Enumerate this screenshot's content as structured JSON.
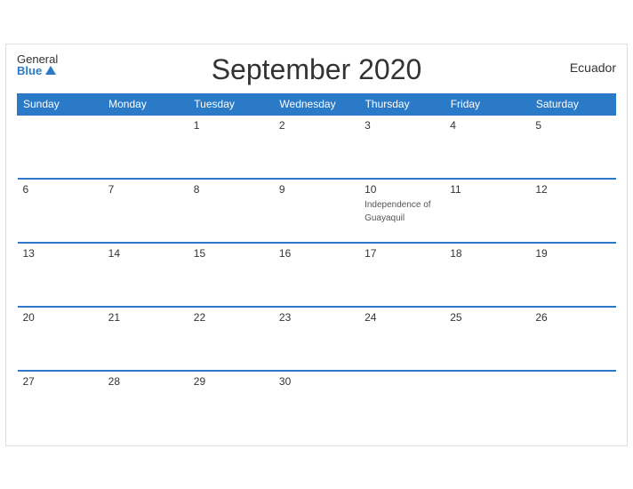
{
  "header": {
    "title": "September 2020",
    "country": "Ecuador",
    "logo_general": "General",
    "logo_blue": "Blue"
  },
  "weekdays": [
    "Sunday",
    "Monday",
    "Tuesday",
    "Wednesday",
    "Thursday",
    "Friday",
    "Saturday"
  ],
  "weeks": [
    [
      {
        "day": "",
        "empty": true
      },
      {
        "day": "",
        "empty": true
      },
      {
        "day": "1",
        "empty": false
      },
      {
        "day": "2",
        "empty": false
      },
      {
        "day": "3",
        "empty": false
      },
      {
        "day": "4",
        "empty": false
      },
      {
        "day": "5",
        "empty": false
      }
    ],
    [
      {
        "day": "6",
        "empty": false
      },
      {
        "day": "7",
        "empty": false
      },
      {
        "day": "8",
        "empty": false
      },
      {
        "day": "9",
        "empty": false
      },
      {
        "day": "10",
        "empty": false,
        "holiday": "Independence of Guayaquil"
      },
      {
        "day": "11",
        "empty": false
      },
      {
        "day": "12",
        "empty": false
      }
    ],
    [
      {
        "day": "13",
        "empty": false
      },
      {
        "day": "14",
        "empty": false
      },
      {
        "day": "15",
        "empty": false
      },
      {
        "day": "16",
        "empty": false
      },
      {
        "day": "17",
        "empty": false
      },
      {
        "day": "18",
        "empty": false
      },
      {
        "day": "19",
        "empty": false
      }
    ],
    [
      {
        "day": "20",
        "empty": false
      },
      {
        "day": "21",
        "empty": false
      },
      {
        "day": "22",
        "empty": false
      },
      {
        "day": "23",
        "empty": false
      },
      {
        "day": "24",
        "empty": false
      },
      {
        "day": "25",
        "empty": false
      },
      {
        "day": "26",
        "empty": false
      }
    ],
    [
      {
        "day": "27",
        "empty": false
      },
      {
        "day": "28",
        "empty": false
      },
      {
        "day": "29",
        "empty": false
      },
      {
        "day": "30",
        "empty": false
      },
      {
        "day": "",
        "empty": true
      },
      {
        "day": "",
        "empty": true
      },
      {
        "day": "",
        "empty": true
      }
    ]
  ]
}
